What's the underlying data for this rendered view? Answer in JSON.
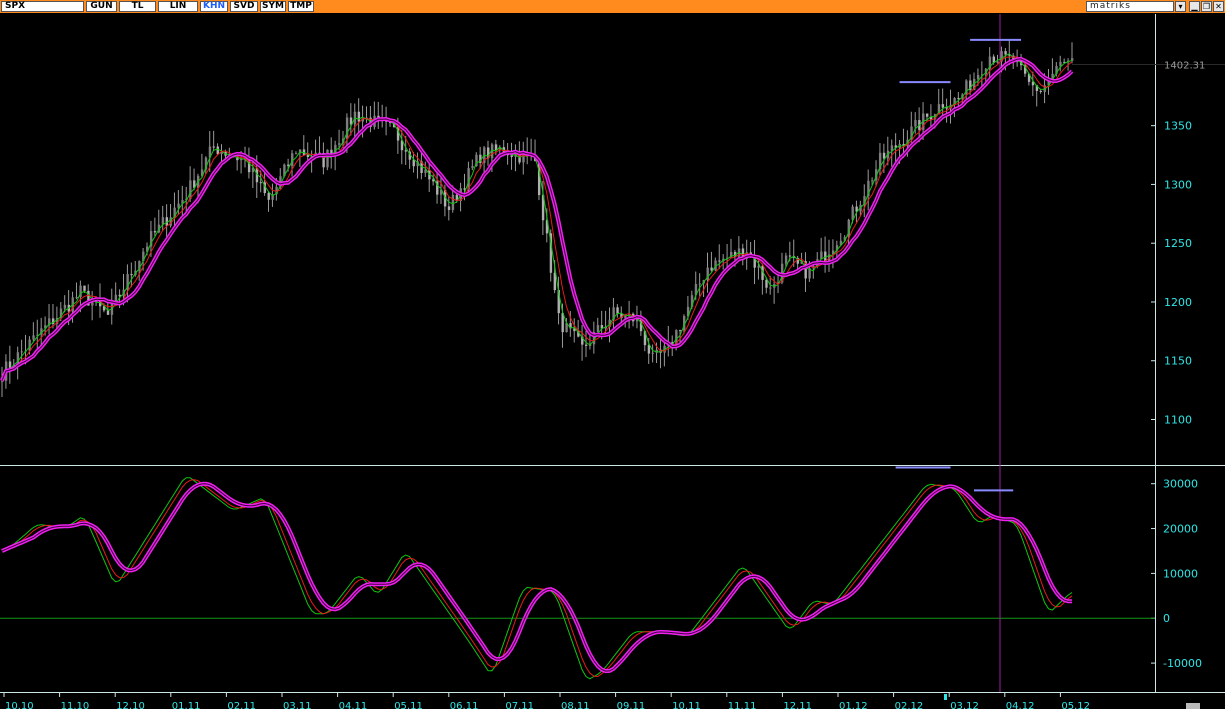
{
  "toolbar": {
    "symbol": "SPX",
    "buttons": [
      "GUN",
      "TL",
      "LIN",
      "KHN",
      "SVD",
      "SYM",
      "TMP"
    ],
    "active": "KHN",
    "brand": "matriks",
    "accent": "#ff8a1e"
  },
  "chart_data": [
    {
      "type": "line",
      "panel": "price",
      "ylim": [
        1063,
        1445
      ],
      "yticks": [
        1100,
        1150,
        1200,
        1250,
        1300,
        1350
      ],
      "last_value_label": "1402.31",
      "x_tick_labels": [
        "10.10",
        "11.10",
        "12.10",
        "01.11",
        "02.11",
        "03.11",
        "04.11",
        "05.11",
        "06.11",
        "07.11",
        "08.11",
        "09.11",
        "10.11",
        "11.11",
        "12.11",
        "01.12",
        "02.12",
        "03.12",
        "04.12",
        "05.12"
      ],
      "price_anchors": [
        [
          0,
          1140
        ],
        [
          10,
          1175
        ],
        [
          20,
          1208
        ],
        [
          27,
          1188
        ],
        [
          37,
          1250
        ],
        [
          47,
          1292
        ],
        [
          54,
          1332
        ],
        [
          62,
          1320
        ],
        [
          68,
          1285
        ],
        [
          75,
          1330
        ],
        [
          82,
          1320
        ],
        [
          90,
          1360
        ],
        [
          100,
          1345
        ],
        [
          110,
          1300
        ],
        [
          114,
          1280
        ],
        [
          122,
          1325
        ],
        [
          128,
          1330
        ],
        [
          136,
          1320
        ],
        [
          142,
          1185
        ],
        [
          148,
          1160
        ],
        [
          156,
          1190
        ],
        [
          162,
          1185
        ],
        [
          166,
          1150
        ],
        [
          170,
          1160
        ],
        [
          180,
          1230
        ],
        [
          190,
          1245
        ],
        [
          196,
          1210
        ],
        [
          200,
          1235
        ],
        [
          206,
          1225
        ],
        [
          215,
          1262
        ],
        [
          224,
          1320
        ],
        [
          232,
          1345
        ],
        [
          240,
          1370
        ],
        [
          244,
          1372
        ],
        [
          252,
          1410
        ],
        [
          258,
          1405
        ],
        [
          262,
          1385
        ],
        [
          265,
          1380
        ],
        [
          270,
          1402
        ]
      ],
      "series": [
        {
          "name": "",
          "color": "#9a9a9a",
          "style": "candles"
        },
        {
          "name": "",
          "color": "#11c411",
          "lag": 1
        },
        {
          "name": "",
          "color": "#e81a1a",
          "lag": 2
        },
        {
          "name": "",
          "color": "#f020f0",
          "lag": 4,
          "double": true
        }
      ],
      "guide_lines": [
        {
          "from": 229,
          "to": 242,
          "y": 1387,
          "color": "#8a8aff"
        },
        {
          "from": 247,
          "to": 260,
          "y": 1423,
          "color": "#8a8aff"
        }
      ]
    },
    {
      "type": "line",
      "panel": "oscillator",
      "ylim": [
        -16000,
        33500
      ],
      "yticks": [
        -10000,
        0,
        10000,
        20000,
        30000
      ],
      "zero_line_color": "#129612",
      "anchors": [
        [
          0,
          15000
        ],
        [
          8,
          21000
        ],
        [
          15,
          20000
        ],
        [
          20,
          23000
        ],
        [
          28,
          7000
        ],
        [
          46,
          32000
        ],
        [
          58,
          24000
        ],
        [
          66,
          27000
        ],
        [
          78,
          1000
        ],
        [
          82,
          1000
        ],
        [
          90,
          10000
        ],
        [
          95,
          5000
        ],
        [
          102,
          15000
        ],
        [
          110,
          5000
        ],
        [
          118,
          -5000
        ],
        [
          124,
          -13000
        ],
        [
          132,
          7000
        ],
        [
          140,
          6000
        ],
        [
          148,
          -14000
        ],
        [
          152,
          -12000
        ],
        [
          160,
          -3000
        ],
        [
          166,
          -3000
        ],
        [
          174,
          -4000
        ],
        [
          188,
          12000
        ],
        [
          200,
          -3000
        ],
        [
          206,
          4000
        ],
        [
          211,
          3000
        ],
        [
          235,
          30000
        ],
        [
          242,
          29000
        ],
        [
          248,
          21000
        ],
        [
          252,
          23000
        ],
        [
          258,
          21000
        ],
        [
          266,
          1000
        ],
        [
          272,
          6000
        ]
      ],
      "series": [
        {
          "name": "",
          "color": "#11c411",
          "lag": 1
        },
        {
          "name": "",
          "color": "#e81a1a",
          "lag": 2
        },
        {
          "name": "",
          "color": "#f020f0",
          "lag": 4,
          "double": true
        }
      ],
      "guide_lines": [
        {
          "from": 228,
          "to": 242,
          "y": 33600,
          "color": "#8a8aff"
        },
        {
          "from": 248,
          "to": 258,
          "y": 28500,
          "color": "#8a8aff"
        }
      ]
    }
  ],
  "vertical_marker_color": "#a020a0",
  "axis_label_color": "#2ee6e6"
}
